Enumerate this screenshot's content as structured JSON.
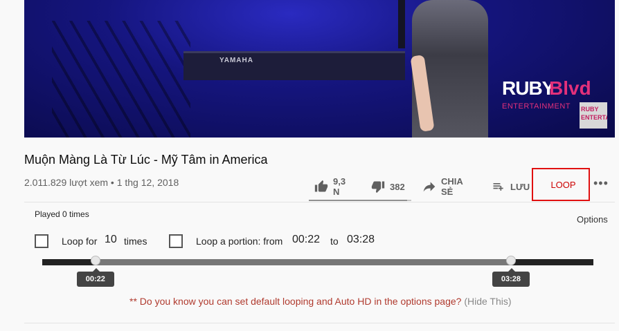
{
  "video": {
    "keyboard_brand": "YAMAHA",
    "logo": {
      "ruby": "RUBY",
      "blvd": "Blvd",
      "entertainment": "ENTERTAINMENT"
    }
  },
  "title": "Muộn Màng Là Từ Lúc - Mỹ Tâm in America",
  "meta": "2.011.829 lượt xem • 1 thg 12, 2018",
  "actions": {
    "like_count": "9,3 N",
    "dislike_count": "382",
    "share_label": "CHIA SẺ",
    "save_label": "LƯU",
    "loop_label": "LOOP",
    "more_label": "•••",
    "sentiment_like_ratio": 0.96
  },
  "loop_panel": {
    "played_text": "Played 0 times",
    "options_label": "Options",
    "loop_for_label": "Loop for",
    "loop_count": "10",
    "times_label": "times",
    "portion_label": "Loop a portion: from",
    "from_time": "00:22",
    "to_label": "to",
    "to_time": "03:28",
    "slider": {
      "from_fraction": 0.0965,
      "to_fraction": 0.8505
    },
    "tip_red": "** Do you know you can set default looping and Auto HD in the options page?",
    "tip_hide": "(Hide This)"
  },
  "colors": {
    "loop_red": "#cc0000",
    "loop_border": "#e01010",
    "tip_red": "#b03a2e"
  }
}
